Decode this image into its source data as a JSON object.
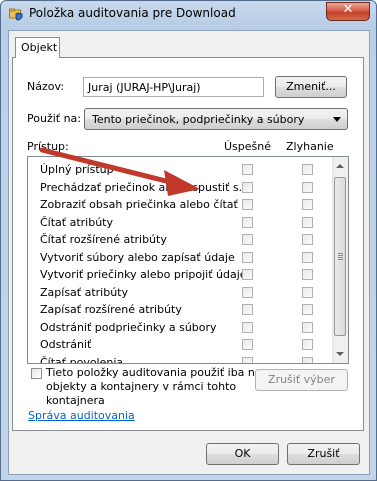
{
  "window": {
    "title": "Položka auditovania pre Download",
    "close_glyph": "✕",
    "icon": "folder-shield-icon"
  },
  "tabs": [
    {
      "label": "Objekt"
    }
  ],
  "name_field": {
    "label": "Názov:",
    "value": "Juraj (JURAJ-HP\\Juraj)",
    "change_button": "Zmeniť..."
  },
  "apply_to": {
    "label": "Použiť na:",
    "selected": "Tento priečinok, podpriečinky a súbory"
  },
  "access": {
    "label": "Prístup:",
    "col_success": "Úspešné",
    "col_failure": "Zlyhanie",
    "rows": [
      {
        "name": "Úplný prístup"
      },
      {
        "name": "Prechádzať priečinok alebo spustiť s..."
      },
      {
        "name": "Zobraziť obsah priečinka alebo čítať ..."
      },
      {
        "name": "Čítať atribúty"
      },
      {
        "name": "Čítať rozšírené atribúty"
      },
      {
        "name": "Vytvoriť súbory alebo zapísať údaje"
      },
      {
        "name": "Vytvoriť priečinky alebo pripojiť údaje"
      },
      {
        "name": "Zapísať atribúty"
      },
      {
        "name": "Zapísať rozšírené atribúty"
      },
      {
        "name": "Odstrániť podpriečinky a súbory"
      },
      {
        "name": "Odstrániť"
      },
      {
        "name": "Čítať povolenia"
      }
    ]
  },
  "apply_only": {
    "line1": "Tieto položky auditovania použiť iba na",
    "line2": "objekty a kontajnery v rámci tohto",
    "line3": "kontajnera",
    "checked": false
  },
  "clear_all_button": "Zrušiť výber",
  "manage_link": "Správa auditovania",
  "footer": {
    "ok_button": "OK",
    "cancel_button": "Zrušiť"
  },
  "colors": {
    "annotation_arrow": "#c0392b",
    "link": "#0066cc",
    "close_button": "#c2412a"
  }
}
